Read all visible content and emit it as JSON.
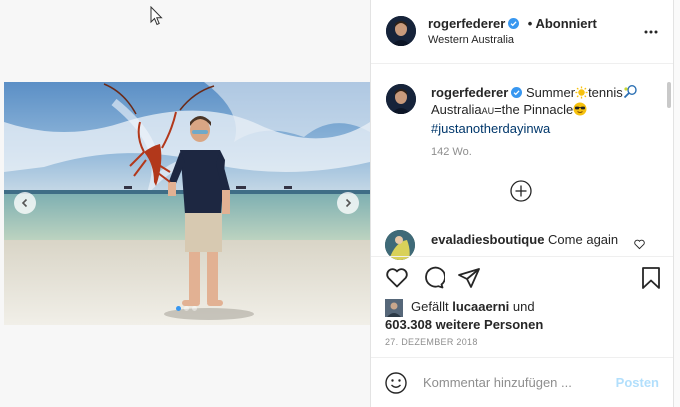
{
  "post": {
    "username": "rogerfederer",
    "follow_status": "• Abonniert",
    "location": "Western Australia"
  },
  "caption": {
    "username": "rogerfederer",
    "text_1": "Summer",
    "text_2": "tennis",
    "text_3": "Australia",
    "flag_text": "AU",
    "text_4": "=the Pinnacle",
    "hashtag": "#justanotherdayinwa",
    "age": "142 Wo."
  },
  "comment": {
    "username": "evaladiesboutique",
    "text": "Come again"
  },
  "likes": {
    "prefix": "Gefällt",
    "liker": "lucaaerni",
    "joiner": "und",
    "others": "603.308 weitere Personen"
  },
  "date": "27. DEZEMBER 2018",
  "add_comment": {
    "placeholder": "Kommentar hinzufügen ...",
    "post_label": "Posten"
  },
  "carousel": {
    "slides": 3,
    "current": 1
  },
  "colors": {
    "accent": "#3897f0",
    "verified": "#3897f0",
    "hashtag": "#00376b",
    "post_disabled": "#b2dffc"
  },
  "icons": [
    "more-options-icon",
    "verified-icon",
    "sun-emoji",
    "tennis-racket-emoji",
    "sunglasses-emoji",
    "add-circle-icon",
    "heart-icon",
    "comment-icon",
    "share-icon",
    "bookmark-icon",
    "emoji-icon",
    "chevron-left-icon",
    "chevron-right-icon"
  ]
}
